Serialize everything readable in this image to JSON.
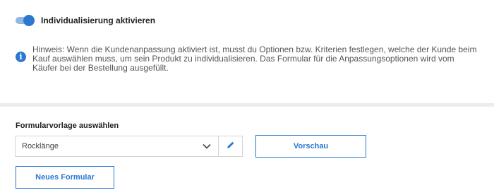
{
  "customization": {
    "toggle_label": "Individualisierung aktivieren",
    "enabled": true
  },
  "hint": {
    "icon": "info-icon",
    "text": "Hinweis: Wenn die Kundenanpassung aktiviert ist, musst du Optionen bzw. Kriterien festlegen, welche der Kunde beim Kauf auswählen muss, um sein Produkt zu individualisieren. Das Formular für die Anpassungsoptionen wird vom Käufer bei der Bestellung ausgefüllt."
  },
  "template_section": {
    "title": "Formularvorlage auswählen",
    "selected_value": "Rocklänge",
    "preview_label": "Vorschau",
    "new_form_label": "Neues Formular"
  },
  "colors": {
    "accent": "#2a78d0",
    "toggle_track": "#8fb8e6",
    "divider": "#ececec"
  }
}
